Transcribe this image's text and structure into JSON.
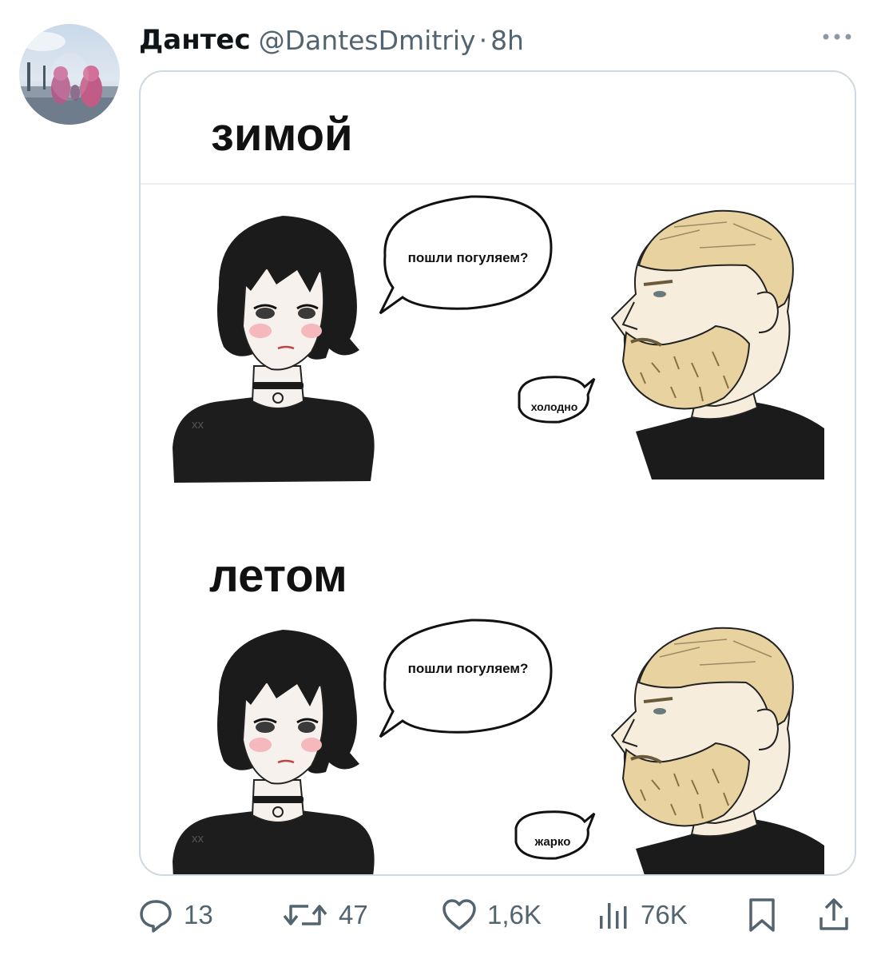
{
  "tweet": {
    "author_name": "Дантес",
    "author_handle": "@DantesDmitriy",
    "separator": "·",
    "timestamp": "8h"
  },
  "meme": {
    "panel_top": {
      "caption": "зимой",
      "girl_bubble": "пошли погуляем?",
      "guy_bubble": "холодно"
    },
    "panel_bottom": {
      "caption": "летом",
      "girl_bubble": "пошли погуляем?",
      "guy_bubble": "жарко"
    }
  },
  "actions": {
    "reply_count": "13",
    "repost_count": "47",
    "like_count": "1,6K",
    "views_count": "76K"
  },
  "icons": {
    "more": "more-dots-icon",
    "reply": "reply-bubble-icon",
    "repost": "repost-arrows-icon",
    "like": "heart-icon",
    "views": "bar-chart-icon",
    "bookmark": "bookmark-icon",
    "share": "share-upload-icon"
  },
  "colors": {
    "text_primary": "#0f1419",
    "text_secondary": "#536471",
    "card_border": "#cfd9de",
    "hair_blond": "#e8d3a0",
    "blush": "#f4b8bd"
  }
}
